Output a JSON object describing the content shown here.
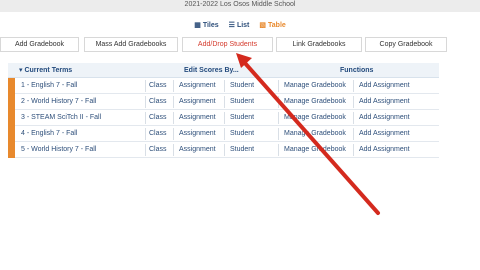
{
  "header": {
    "school_title": "2021-2022 Los Osos Middle School"
  },
  "view_toggle": [
    {
      "label": "Tiles",
      "icon": "grid-icon"
    },
    {
      "label": "List",
      "icon": "list-icon"
    },
    {
      "label": "Table",
      "icon": "table-icon"
    }
  ],
  "buttons": {
    "add_gradebook": "Add Gradebook",
    "mass_add_gradebooks": "Mass Add Gradebooks",
    "add_drop_students": "Add/Drop Students",
    "link_gradebooks": "Link Gradebooks",
    "copy_gradebook": "Copy Gradebook"
  },
  "table": {
    "col_current_terms": "Current Terms",
    "col_edit_scores": "Edit Scores By...",
    "col_functions": "Functions",
    "rows": [
      {
        "term": "1 - English 7 - Fall",
        "class": "Class",
        "assignment": "Assignment",
        "student": "Student",
        "manage": "Manage Gradebook",
        "add": "Add Assignment"
      },
      {
        "term": "2 - World History 7 - Fall",
        "class": "Class",
        "assignment": "Assignment",
        "student": "Student",
        "manage": "Manage Gradebook",
        "add": "Add Assignment"
      },
      {
        "term": "3 - STEAM SciTch II - Fall",
        "class": "Class",
        "assignment": "Assignment",
        "student": "Student",
        "manage": "Manage Gradebook",
        "add": "Add Assignment"
      },
      {
        "term": "4 - English 7 - Fall",
        "class": "Class",
        "assignment": "Assignment",
        "student": "Student",
        "manage": "Manage Gradebook",
        "add": "Add Assignment"
      },
      {
        "term": "5 - World History 7 - Fall",
        "class": "Class",
        "assignment": "Assignment",
        "student": "Student",
        "manage": "Manage Gradebook",
        "add": "Add Assignment"
      }
    ]
  },
  "colors": {
    "accent_orange": "#e8892d",
    "link_blue": "#2e4f7a",
    "header_blue": "#244b7d",
    "annotation_red": "#d42a1e"
  }
}
